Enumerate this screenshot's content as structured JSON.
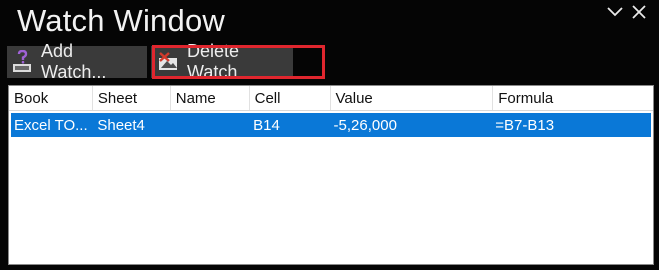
{
  "window": {
    "title": "Watch Window"
  },
  "toolbar": {
    "add_label": "Add Watch...",
    "delete_label": "Delete Watch"
  },
  "table": {
    "columns": [
      "Book",
      "Sheet",
      "Name",
      "Cell",
      "Value",
      "Formula"
    ],
    "rows": [
      {
        "book": "Excel TO...",
        "sheet": "Sheet4",
        "name": "",
        "cell": "B14",
        "value": "-5,26,000",
        "formula": "=B7-B13"
      }
    ]
  },
  "colors": {
    "selection": "#0a78d7",
    "highlight": "#e0262e",
    "background": "#050505"
  },
  "icons": {
    "add": "add-watch-icon",
    "delete": "delete-watch-icon",
    "dropdown": "chevron-down-icon",
    "close": "close-icon"
  }
}
